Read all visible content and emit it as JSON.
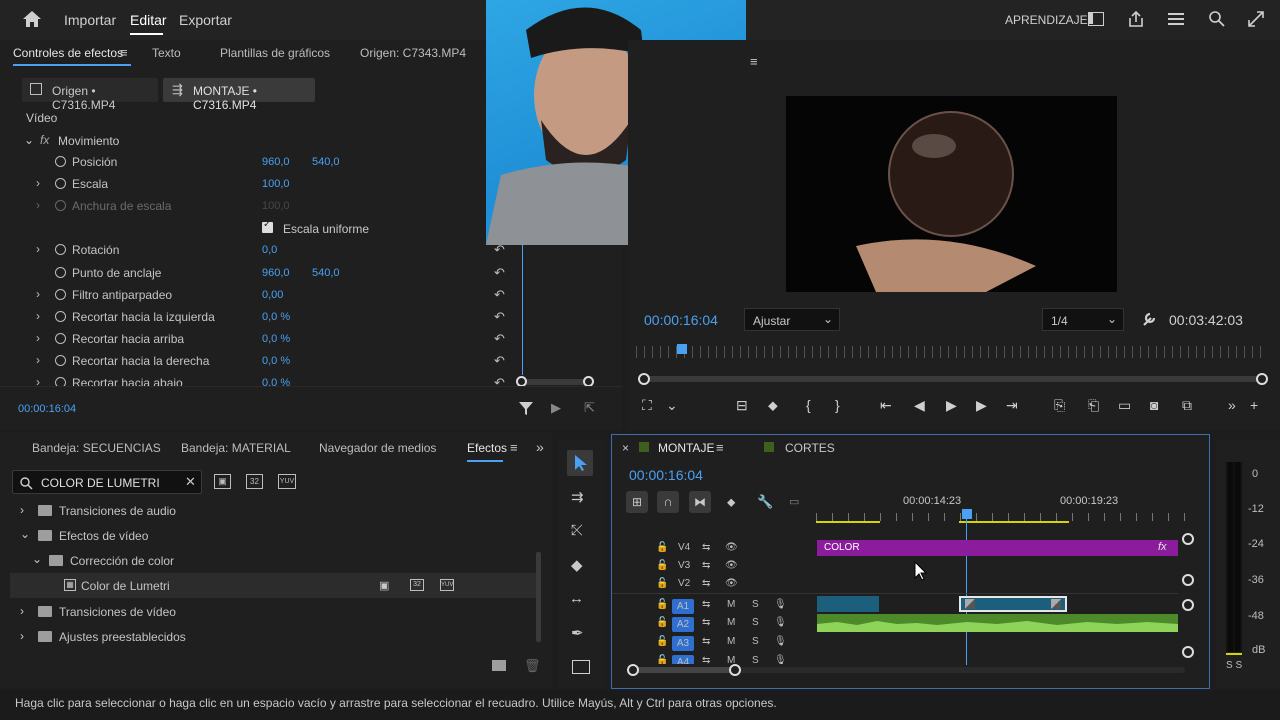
{
  "topbar": {
    "nav": [
      "Importar",
      "Editar",
      "Exportar"
    ],
    "learn": "APRENDIZAJE"
  },
  "effect_controls": {
    "tabs": [
      "Controles de efectos",
      "Texto",
      "Plantillas de gráficos",
      "Origen: C7343.MP4"
    ],
    "source_chip": "Origen • C7316.MP4",
    "sequence_chip": "MONTAJE • C7316.MP4",
    "section": "Vídeo",
    "fx_label": "fx",
    "motion": "Movimiento",
    "uniform": "Escala uniforme",
    "rows": [
      {
        "label": "Posición",
        "v1": "960,0",
        "v2": "540,0"
      },
      {
        "label": "Escala",
        "v1": "100,0",
        "v2": ""
      },
      {
        "label": "Anchura de escala",
        "v1": "100,0",
        "v2": ""
      },
      {
        "label": "Rotación",
        "v1": "0,0",
        "v2": ""
      },
      {
        "label": "Punto de anclaje",
        "v1": "960,0",
        "v2": "540,0"
      },
      {
        "label": "Filtro antiparpadeo",
        "v1": "0,00",
        "v2": ""
      },
      {
        "label": "Recortar hacia la izquierda",
        "v1": "0,0 %",
        "v2": ""
      },
      {
        "label": "Recortar hacia arriba",
        "v1": "0,0 %",
        "v2": ""
      },
      {
        "label": "Recortar hacia la derecha",
        "v1": "0,0 %",
        "v2": ""
      },
      {
        "label": "Recortar hacia abajo",
        "v1": "0,0 %",
        "v2": ""
      }
    ],
    "timecode": "00:00:16:04"
  },
  "program": {
    "timecode": "00:00:16:04",
    "fit": "Ajustar",
    "resolution": "1/4",
    "duration": "00:03:42:03"
  },
  "project": {
    "tabs": [
      "Bandeja: SECUENCIAS",
      "Bandeja: MATERIAL",
      "Navegador de medios",
      "Efectos"
    ],
    "search": "COLOR DE LUMETRI",
    "badge_32": "32",
    "badge_yuv": "YUV",
    "tree": [
      "Transiciones de audio",
      "Efectos de vídeo",
      "Corrección de color",
      "Color de Lumetri",
      "Transiciones de vídeo",
      "Ajustes preestablecidos"
    ]
  },
  "timeline": {
    "tabs": [
      "MONTAJE",
      "CORTES"
    ],
    "timecode": "00:00:16:04",
    "ruler": [
      "00:00:14:23",
      "00:00:19:23"
    ],
    "video_tracks": [
      "V4",
      "V3",
      "V2"
    ],
    "audio_tracks": [
      "A1",
      "A2",
      "A3",
      "A4"
    ],
    "m": "M",
    "s": "S",
    "clip_color": "COLOR",
    "clip_fx": "fx"
  },
  "meter": {
    "labels": [
      "0",
      "-12",
      "-24",
      "-36",
      "-48",
      "dB"
    ],
    "footer": "S S"
  },
  "status": "Haga clic para seleccionar o haga clic en un espacio vacío y arrastre para seleccionar el recuadro. Utilice Mayús, Alt y Ctrl para otras opciones."
}
